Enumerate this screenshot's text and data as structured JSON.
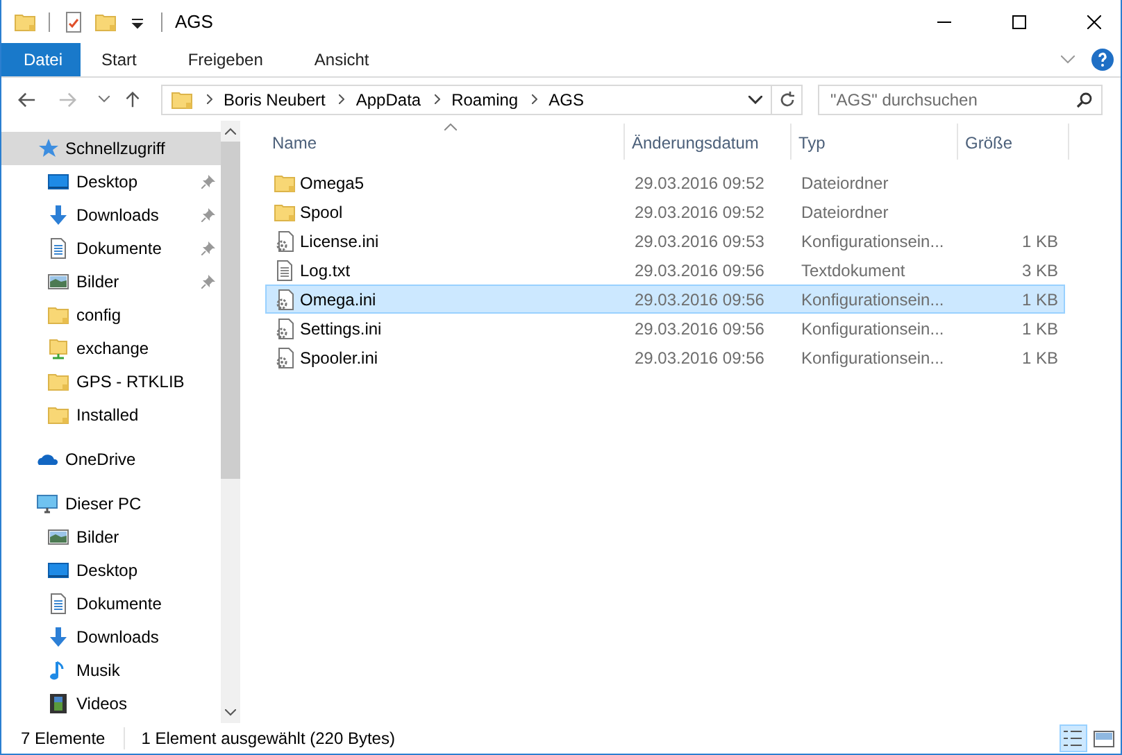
{
  "window": {
    "title": "AGS"
  },
  "quick_access_toolbar": [
    {
      "kind": "folder"
    },
    {
      "kind": "properties"
    },
    {
      "kind": "new-folder"
    },
    {
      "kind": "customize"
    }
  ],
  "ribbon": {
    "tabs": [
      {
        "label": "Datei",
        "kind": "file"
      },
      {
        "label": "Start",
        "kind": "tab"
      },
      {
        "label": "Freigeben",
        "kind": "tab"
      },
      {
        "label": "Ansicht",
        "kind": "tab"
      }
    ]
  },
  "address": {
    "crumbs": [
      "Boris Neubert",
      "AppData",
      "Roaming",
      "AGS"
    ]
  },
  "search": {
    "placeholder": "\"AGS\" durchsuchen"
  },
  "sidebar": {
    "items": [
      {
        "label": "Schnellzugriff",
        "kind": "star",
        "selected": true,
        "children": [
          {
            "label": "Desktop",
            "kind": "desktop",
            "pinned": true,
            "selected": false
          },
          {
            "label": "Downloads",
            "kind": "download",
            "pinned": true,
            "selected": false
          },
          {
            "label": "Dokumente",
            "kind": "document",
            "pinned": true,
            "selected": false
          },
          {
            "label": "Bilder",
            "kind": "picture",
            "pinned": true,
            "selected": false
          },
          {
            "label": "config",
            "kind": "folder",
            "pinned": false,
            "selected": false
          },
          {
            "label": "exchange",
            "kind": "shared-folder",
            "pinned": false,
            "selected": false
          },
          {
            "label": "GPS - RTKLIB",
            "kind": "folder",
            "pinned": false,
            "selected": false
          },
          {
            "label": "Installed",
            "kind": "folder",
            "pinned": false,
            "selected": false
          }
        ]
      },
      {
        "label": "OneDrive",
        "kind": "cloud",
        "selected": false
      },
      {
        "label": "Dieser PC",
        "kind": "pc",
        "selected": false,
        "children": [
          {
            "label": "Bilder",
            "kind": "picture",
            "pinned": false,
            "selected": false
          },
          {
            "label": "Desktop",
            "kind": "desktop",
            "pinned": false,
            "selected": false
          },
          {
            "label": "Dokumente",
            "kind": "document",
            "pinned": false,
            "selected": false
          },
          {
            "label": "Downloads",
            "kind": "download",
            "pinned": false,
            "selected": false
          },
          {
            "label": "Musik",
            "kind": "music",
            "pinned": false,
            "selected": false
          },
          {
            "label": "Videos",
            "kind": "video",
            "pinned": false,
            "selected": false
          }
        ]
      }
    ]
  },
  "table": {
    "columns": [
      {
        "label": "Name",
        "sorted": true
      },
      {
        "label": "Änderungsdatum",
        "sorted": false
      },
      {
        "label": "Typ",
        "sorted": false
      },
      {
        "label": "Größe",
        "sorted": false
      }
    ],
    "rows": [
      {
        "name": "Omega5",
        "date": "29.03.2016 09:52",
        "type": "Dateiordner",
        "kind": "folder",
        "selected": false
      },
      {
        "name": "Spool",
        "date": "29.03.2016 09:52",
        "type": "Dateiordner",
        "kind": "folder",
        "selected": false
      },
      {
        "name": "License.ini",
        "date": "29.03.2016 09:53",
        "type": "Konfigurationsein...",
        "size": "1 KB",
        "kind": "ini",
        "selected": false
      },
      {
        "name": "Log.txt",
        "date": "29.03.2016 09:56",
        "type": "Textdokument",
        "size": "3 KB",
        "kind": "txt",
        "selected": false
      },
      {
        "name": "Omega.ini",
        "date": "29.03.2016 09:56",
        "type": "Konfigurationsein...",
        "size": "1 KB",
        "kind": "ini",
        "selected": true
      },
      {
        "name": "Settings.ini",
        "date": "29.03.2016 09:56",
        "type": "Konfigurationsein...",
        "size": "1 KB",
        "kind": "ini",
        "selected": false
      },
      {
        "name": "Spooler.ini",
        "date": "29.03.2016 09:56",
        "type": "Konfigurationsein...",
        "size": "1 KB",
        "kind": "ini",
        "selected": false
      }
    ]
  },
  "status_bar": {
    "count": "7 Elemente",
    "selection": "1 Element ausgewählt (220 Bytes)",
    "views": [
      {
        "kind": "details",
        "selected": true
      },
      {
        "kind": "tiles",
        "selected": false
      }
    ]
  }
}
